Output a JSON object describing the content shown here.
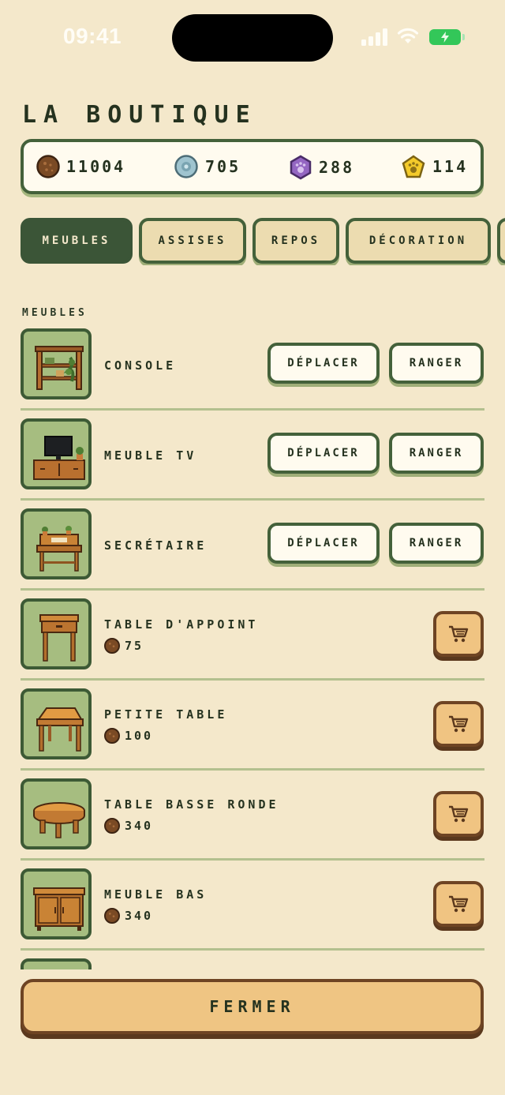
{
  "status_bar": {
    "time": "09:41"
  },
  "shop": {
    "title": "LA BOUTIQUE",
    "currencies": [
      {
        "icon": "coin-icon",
        "value": "11004",
        "color": "#7a4a24"
      },
      {
        "icon": "gear-token-icon",
        "value": "705",
        "color": "#8fb6c4"
      },
      {
        "icon": "paw-hexagon-icon",
        "value": "288",
        "color": "#8d5db8"
      },
      {
        "icon": "paw-pentagon-icon",
        "value": "114",
        "color": "#f2c624"
      }
    ],
    "tabs": [
      {
        "label": "MEUBLES",
        "active": true
      },
      {
        "label": "ASSISES",
        "active": false
      },
      {
        "label": "REPOS",
        "active": false
      },
      {
        "label": "DÉCORATION",
        "active": false
      }
    ],
    "section_label": "MEUBLES",
    "owned_items": [
      {
        "name": "CONSOLE",
        "icon": "console-shelf-icon",
        "move_label": "DÉPLACER",
        "store_label": "RANGER"
      },
      {
        "name": "MEUBLE TV",
        "icon": "tv-stand-icon",
        "move_label": "DÉPLACER",
        "store_label": "RANGER"
      },
      {
        "name": "SECRÉTAIRE",
        "icon": "secretary-desk-icon",
        "move_label": "DÉPLACER",
        "store_label": "RANGER"
      }
    ],
    "shop_items": [
      {
        "name": "TABLE D'APPOINT",
        "price": "75",
        "icon": "side-table-icon"
      },
      {
        "name": "PETITE TABLE",
        "price": "100",
        "icon": "small-table-icon"
      },
      {
        "name": "TABLE BASSE RONDE",
        "price": "340",
        "icon": "round-coffee-table-icon"
      },
      {
        "name": "MEUBLE BAS",
        "price": "340",
        "icon": "low-cabinet-icon"
      }
    ],
    "close_label": "FERMER"
  }
}
